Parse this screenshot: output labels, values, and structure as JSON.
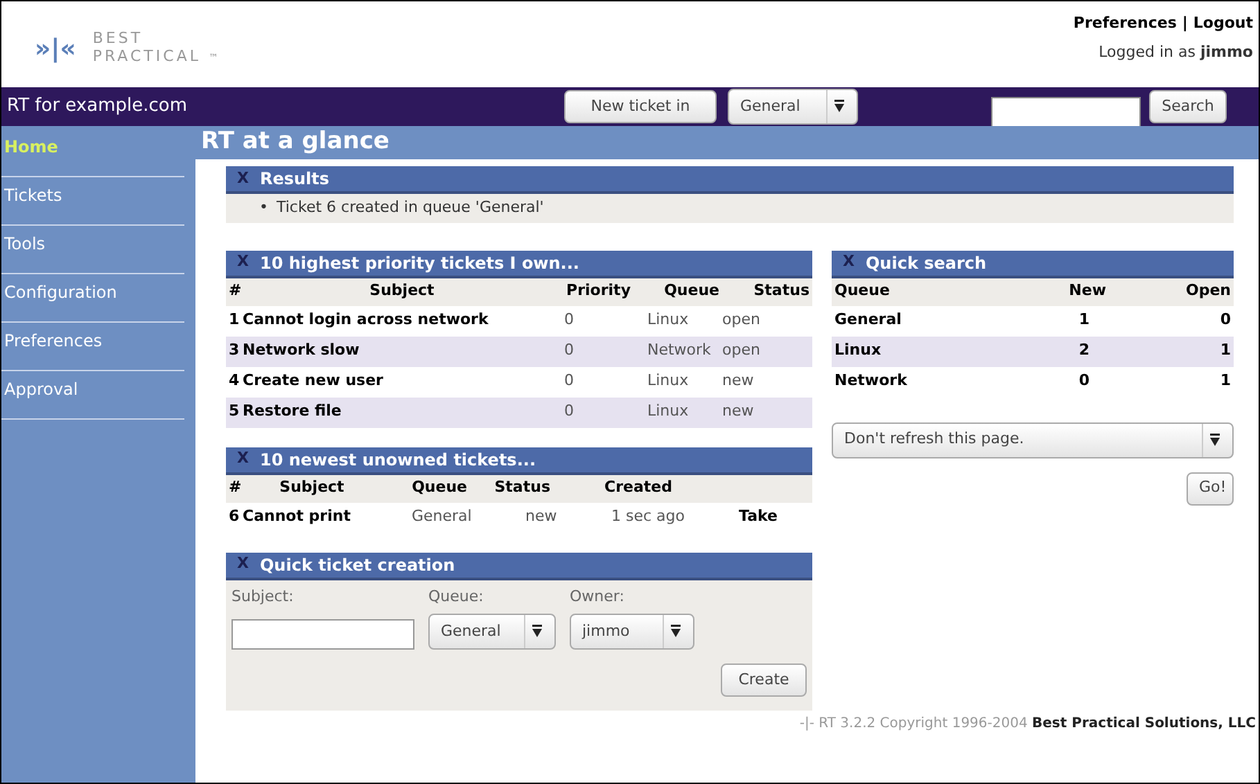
{
  "logo": {
    "mark": "»|«",
    "line1": "BEST",
    "line2": "PRACTICAL",
    "tm": "™"
  },
  "user_links": {
    "preferences": "Preferences",
    "separator": "|",
    "logout": "Logout",
    "logged_in": "Logged in as **jimmo**"
  },
  "nav": {
    "title": "RT for example.com",
    "new_ticket_button": "New ticket in",
    "queue_select": "General",
    "search_button": "Search"
  },
  "sidebar": {
    "items": [
      {
        "label": "Home",
        "selected": true
      },
      {
        "label": "Tickets",
        "selected": false
      },
      {
        "label": "Tools",
        "selected": false
      },
      {
        "label": "Configuration",
        "selected": false
      },
      {
        "label": "Preferences",
        "selected": false
      },
      {
        "label": "Approval",
        "selected": false
      }
    ]
  },
  "page_title": "RT at a glance",
  "results": {
    "close": "X",
    "title": "Results",
    "bullet": "•",
    "messages": [
      "Ticket 6 created in queue 'General'"
    ]
  },
  "my_tickets": {
    "close": "X",
    "title": "10 highest priority tickets I own...",
    "columns": [
      "#",
      "Subject",
      "Priority",
      "Queue",
      "Status"
    ],
    "rows": [
      [
        "1",
        "Cannot login across network",
        "0",
        "Linux",
        "open"
      ],
      [
        "3",
        "Network slow",
        "0",
        "Network",
        "open"
      ],
      [
        "4",
        "Create new user",
        "0",
        "Linux",
        "new"
      ],
      [
        "5",
        "Restore file",
        "0",
        "Linux",
        "new"
      ]
    ]
  },
  "unowned_tickets": {
    "close": "X",
    "title": "10 newest unowned tickets...",
    "columns": [
      "#",
      "Subject",
      "Queue",
      "Status",
      "Created"
    ],
    "rows": [
      {
        "number": "6",
        "subject": "Cannot print",
        "queue": "General",
        "status": "new",
        "created": "1 sec ago",
        "action": "Take"
      }
    ]
  },
  "quick_create": {
    "close": "X",
    "title": "Quick ticket creation",
    "subject_label": "Subject:",
    "queue_label": "Queue:",
    "queue_value": "General",
    "owner_label": "Owner:",
    "owner_value": "jimmo",
    "create_button": "Create"
  },
  "quick_search": {
    "close": "X",
    "title": "Quick search",
    "columns": [
      "Queue",
      "New",
      "Open"
    ],
    "rows": [
      [
        "General",
        "1",
        "0"
      ],
      [
        "Linux",
        "2",
        "1"
      ],
      [
        "Network",
        "0",
        "1"
      ]
    ],
    "refresh_select": "Don't refresh this page.",
    "go_button": "Go!"
  },
  "footer": "-|- RT 3.2.2 Copyright 1996-2004 **Best Practical Solutions, LLC**"
}
